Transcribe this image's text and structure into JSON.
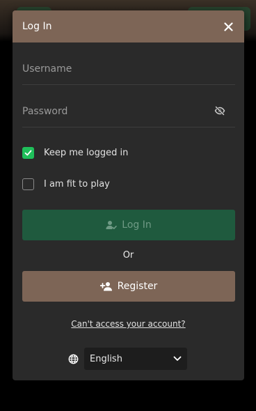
{
  "modal": {
    "title": "Log In"
  },
  "form": {
    "username_placeholder": "Username",
    "password_placeholder": "Password",
    "keep_logged_in_label": "Keep me logged in",
    "keep_logged_in_checked": true,
    "fit_to_play_label": "I am fit to play",
    "fit_to_play_checked": false,
    "login_label": "Log In",
    "or_label": "Or",
    "register_label": "Register",
    "forgot_link": "Can't access your account?"
  },
  "language": {
    "selected": "English"
  },
  "icons": {
    "close": "close-icon",
    "password_toggle": "eye-slash-icon",
    "login": "user-check-icon",
    "register": "user-plus-icon",
    "language": "globe-icon",
    "dropdown": "chevron-down-icon",
    "checkbox": "check-icon"
  },
  "colors": {
    "header": "#7d6556",
    "login_button": "#1f5a3e",
    "register_button": "#7d6556",
    "checkbox_checked": "#1fbf5a",
    "modal_background": "#2a2a2a"
  }
}
